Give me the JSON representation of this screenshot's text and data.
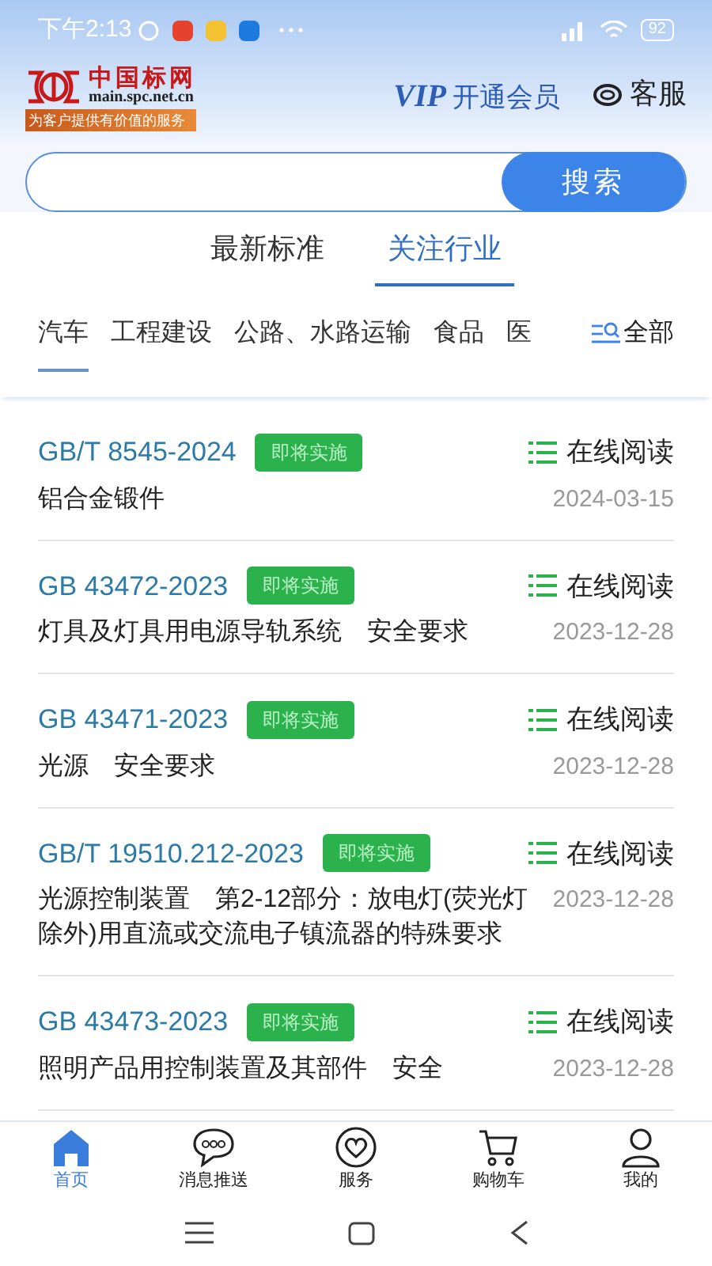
{
  "status_bar": {
    "time": "下午2:13",
    "battery": "92"
  },
  "header": {
    "logo_name": "中国标网",
    "logo_url": "main.spc.net.cn",
    "slogan": "为客户提供有价值的服务",
    "vip_label": "VIP",
    "vip_action": "开通会员",
    "service": "客服"
  },
  "search": {
    "button": "搜索"
  },
  "tabs": [
    {
      "label": "最新标准",
      "selected": false
    },
    {
      "label": "关注行业",
      "selected": true
    }
  ],
  "categories": [
    {
      "label": "汽车",
      "selected": true
    },
    {
      "label": "工程建设",
      "selected": false
    },
    {
      "label": "公路、水路运输",
      "selected": false
    },
    {
      "label": "食品",
      "selected": false
    },
    {
      "label": "医",
      "selected": false
    }
  ],
  "all_button": "全部",
  "standards": [
    {
      "code": "GB/T 8545-2024",
      "badge": "即将实施",
      "read": "在线阅读",
      "title": "铝合金锻件",
      "date": "2024-03-15"
    },
    {
      "code": "GB 43472-2023",
      "badge": "即将实施",
      "read": "在线阅读",
      "title": "灯具及灯具用电源导轨系统　安全要求",
      "date": "2023-12-28"
    },
    {
      "code": "GB 43471-2023",
      "badge": "即将实施",
      "read": "在线阅读",
      "title": "光源　安全要求",
      "date": "2023-12-28"
    },
    {
      "code": "GB/T 19510.212-2023",
      "badge": "即将实施",
      "read": "在线阅读",
      "title": "光源控制装置　第2-12部分：放电灯(荧光灯除外)用直流或交流电子镇流器的特殊要求",
      "date": "2023-12-28"
    },
    {
      "code": "GB 43473-2023",
      "badge": "即将实施",
      "read": "在线阅读",
      "title": "照明产品用控制装置及其部件　安全",
      "date": "2023-12-28"
    }
  ],
  "bottom_nav": [
    {
      "label": "首页",
      "selected": true,
      "kind": "home"
    },
    {
      "label": "消息推送",
      "selected": false,
      "kind": "chat"
    },
    {
      "label": "服务",
      "selected": false,
      "kind": "heart"
    },
    {
      "label": "购物车",
      "selected": false,
      "kind": "cart"
    },
    {
      "label": "我的",
      "selected": false,
      "kind": "user"
    }
  ]
}
